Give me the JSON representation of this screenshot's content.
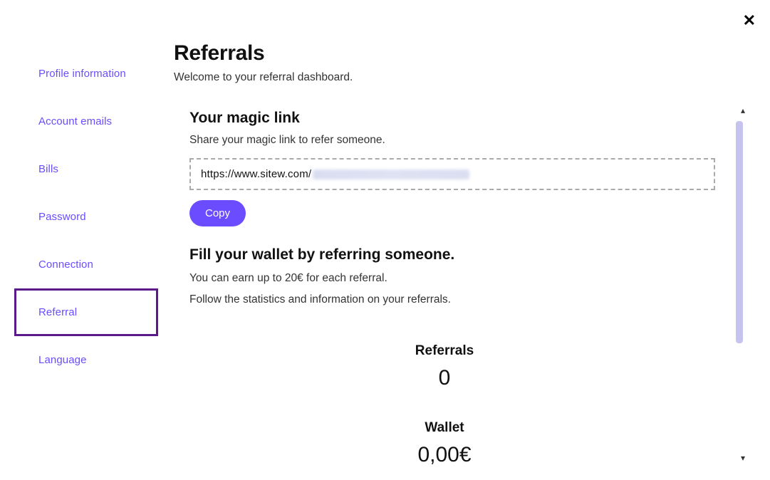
{
  "close_icon": "✕",
  "sidebar": {
    "items": [
      {
        "label": "Profile information"
      },
      {
        "label": "Account emails"
      },
      {
        "label": "Bills"
      },
      {
        "label": "Password"
      },
      {
        "label": "Connection"
      },
      {
        "label": "Referral",
        "active": true
      },
      {
        "label": "Language"
      }
    ]
  },
  "header": {
    "title": "Referrals",
    "subtitle": "Welcome to your referral dashboard."
  },
  "magic_link": {
    "heading": "Your magic link",
    "description": "Share your magic link to refer someone.",
    "url_prefix": "https://www.sitew.com/",
    "copy_label": "Copy"
  },
  "wallet_info": {
    "heading": "Fill your wallet by referring someone.",
    "line1": "You can earn up to 20€ for each referral.",
    "line2": "Follow the statistics and information on your referrals."
  },
  "stats": {
    "referrals_label": "Referrals",
    "referrals_value": "0",
    "wallet_label": "Wallet",
    "wallet_value": "0,00€"
  }
}
